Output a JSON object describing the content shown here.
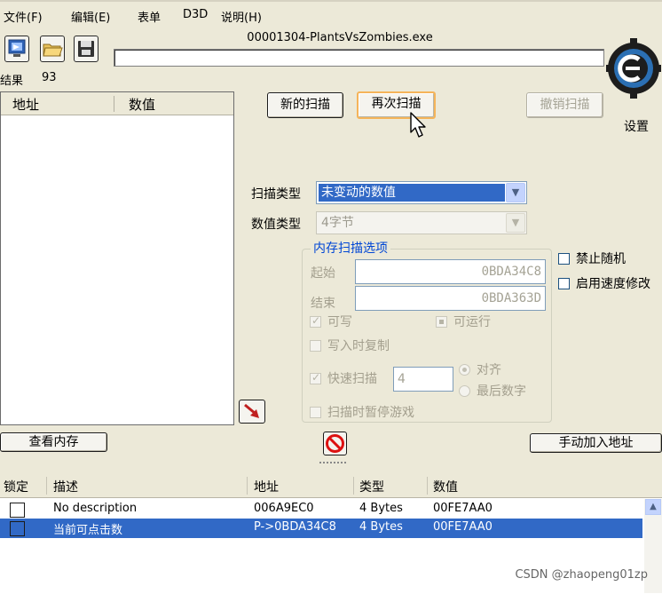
{
  "menu": {
    "file": "文件(F)",
    "edit": "编辑(E)",
    "table": "表单",
    "d3d": "D3D",
    "help": "说明(H)"
  },
  "toolbar": {
    "open_process_icon": "computer-icon",
    "open_file_icon": "folder-open-icon",
    "save_icon": "floppy-disk-icon"
  },
  "process_title": "00001304-PlantsVsZombies.exe",
  "progress": 0,
  "found": {
    "label": "结果",
    "count": "93"
  },
  "results_list": {
    "columns": [
      "地址",
      "数值"
    ]
  },
  "scan": {
    "new_scan": "新的扫描",
    "next_scan": "再次扫描",
    "undo_scan": "撤销扫描",
    "settings": "设置",
    "scan_type_label": "扫描类型",
    "scan_type_value": "未变动的数值",
    "value_type_label": "数值类型",
    "value_type_value": "4字节"
  },
  "memory_options": {
    "title": "内存扫描选项",
    "start_label": "起始",
    "start_value": "0BDA34C8",
    "stop_label": "结束",
    "stop_value": "0BDA363D",
    "writable": "可写",
    "executable": "可运行",
    "copy_on_write": "写入时复制",
    "fast_scan": "快速扫描",
    "fast_scan_value": "4",
    "alignment": "对齐",
    "last_digits": "最后数字",
    "pause_game": "扫描时暂停游戏"
  },
  "extra": {
    "unrandomizer": "禁止随机",
    "speedhack": "启用速度修改"
  },
  "memory_view": "查看内存",
  "add_address": "手动加入地址",
  "address_table": {
    "columns": [
      "锁定",
      "描述",
      "地址",
      "类型",
      "数值"
    ],
    "rows": [
      {
        "locked": false,
        "description": "No description",
        "address": "006A9EC0",
        "type": "4 Bytes",
        "value": "00FE7AA0",
        "selected": false
      },
      {
        "locked": false,
        "description": "当前可点击数",
        "address": "P->0BDA34C8",
        "type": "4 Bytes",
        "value": "00FE7AA0",
        "selected": true
      }
    ]
  },
  "watermark": "CSDN @zhaopeng01zp",
  "colors": {
    "selection": "#3169c6",
    "group_title": "#0046d5",
    "window_bg": "#ece9d8"
  }
}
